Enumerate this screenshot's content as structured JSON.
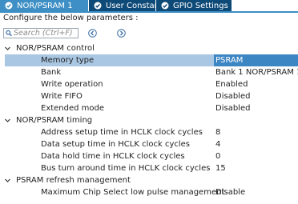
{
  "tabs": [
    {
      "label": "NOR/PSRAM 1",
      "active": true
    },
    {
      "label": "User Constants",
      "active": false
    },
    {
      "label": "GPIO Settings",
      "active": false
    }
  ],
  "configure_label": "Configure the below parameters :",
  "search": {
    "placeholder": "Search (Ctrl+F)"
  },
  "groups": [
    {
      "label": "NOR/PSRAM control",
      "properties": [
        {
          "name": "Memory type",
          "value": "PSRAM",
          "selected": true
        },
        {
          "name": "Bank",
          "value": "Bank 1 NOR/PSRAM 1"
        },
        {
          "name": "Write operation",
          "value": "Enabled"
        },
        {
          "name": "Write FIFO",
          "value": "Disabled"
        },
        {
          "name": "Extended mode",
          "value": "Disabled"
        }
      ]
    },
    {
      "label": "NOR/PSRAM timing",
      "properties": [
        {
          "name": "Address setup time in HCLK clock cycles",
          "value": "8"
        },
        {
          "name": "Data setup time in HCLK clock cycles",
          "value": "4"
        },
        {
          "name": "Data hold time in HCLK clock cycles",
          "value": "0"
        },
        {
          "name": "Bus turn around time in HCLK clock cycles",
          "value": "15"
        }
      ]
    },
    {
      "label": "PSRAM refresh management",
      "properties": [
        {
          "name": "Maximum Chip Select low pulse management",
          "value": "Disable"
        }
      ]
    }
  ],
  "colors": {
    "tab_active": "#3d8fc5",
    "tab_inactive": "#0e4a78",
    "row_selected": "#a9c7e2",
    "value_selected": "#3d86c4"
  }
}
